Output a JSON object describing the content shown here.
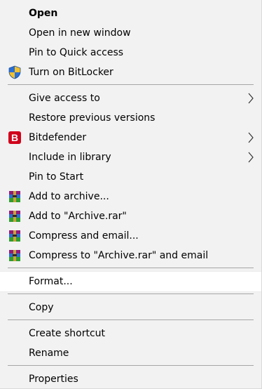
{
  "menu": {
    "items": [
      {
        "label": "Open",
        "bold": true
      },
      {
        "label": "Open in new window"
      },
      {
        "label": "Pin to Quick access"
      },
      {
        "label": "Turn on BitLocker",
        "icon": "shield-icon"
      },
      {
        "label": "Give access to",
        "submenu": true
      },
      {
        "label": "Restore previous versions"
      },
      {
        "label": "Bitdefender",
        "icon": "bitdefender-icon",
        "submenu": true
      },
      {
        "label": "Include in library",
        "submenu": true
      },
      {
        "label": "Pin to Start"
      },
      {
        "label": "Add to archive...",
        "icon": "winrar-icon"
      },
      {
        "label": "Add to \"Archive.rar\"",
        "icon": "winrar-icon"
      },
      {
        "label": "Compress and email...",
        "icon": "winrar-icon"
      },
      {
        "label": "Compress to \"Archive.rar\" and email",
        "icon": "winrar-icon"
      },
      {
        "label": "Format...",
        "highlighted": true
      },
      {
        "label": "Copy"
      },
      {
        "label": "Create shortcut"
      },
      {
        "label": "Rename"
      },
      {
        "label": "Properties"
      }
    ]
  },
  "colors": {
    "menu_background": "#f2f2f2",
    "highlight_background": "#ffffff",
    "separator": "#a6a6a6",
    "bitdefender_red": "#d0021b"
  }
}
